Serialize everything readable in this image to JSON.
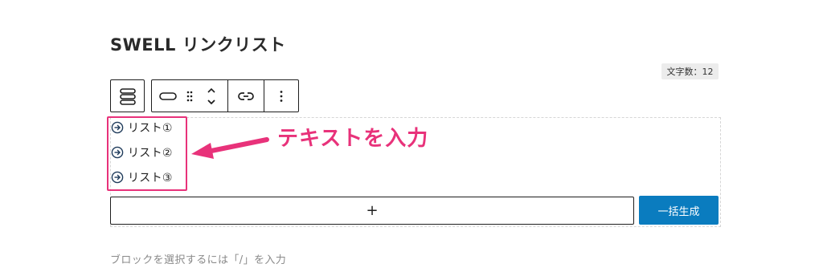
{
  "block": {
    "title": "SWELL リンクリスト",
    "char_count": "文字数：12"
  },
  "toolbar": {
    "block_type_icon": "list-block-icon",
    "style_icon": "button-style-icon",
    "drag_icon": "drag-handle-icon",
    "move_icon": "move-up-down-icon",
    "link_icon": "link-icon",
    "options_icon": "more-vertical-icon"
  },
  "list": {
    "item_icon": "arrow-right-circle-icon",
    "items": [
      {
        "label": "リスト①"
      },
      {
        "label": "リスト②"
      },
      {
        "label": "リスト③"
      }
    ]
  },
  "actions": {
    "add_label": "+",
    "generate_label": "一括生成"
  },
  "annotation": {
    "text": "テキストを入力",
    "color": "#e8327a"
  },
  "placeholder": {
    "text": "ブロックを選択するには「/」を入力"
  },
  "colors": {
    "accent_pink": "#e8327a",
    "button_blue": "#0a7cbf"
  }
}
